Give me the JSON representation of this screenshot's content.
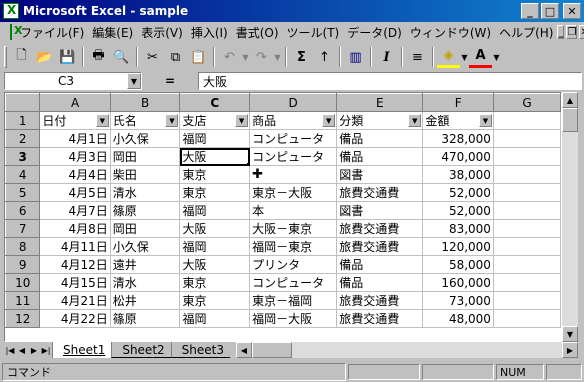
{
  "window": {
    "title": "Microsoft Excel - sample"
  },
  "menu": [
    "ファイル(F)",
    "編集(E)",
    "表示(V)",
    "挿入(I)",
    "書式(O)",
    "ツール(T)",
    "データ(D)",
    "ウィンドウ(W)",
    "ヘルプ(H)"
  ],
  "toolbar": {
    "buttons": [
      {
        "name": "new-icon",
        "glyph": "🗋"
      },
      {
        "name": "open-icon",
        "glyph": "📂"
      },
      {
        "name": "save-icon",
        "glyph": "💾"
      },
      {
        "name": "print-icon",
        "glyph": "🖶"
      },
      {
        "name": "print-preview-icon",
        "glyph": "🔍"
      },
      {
        "name": "cut-icon",
        "glyph": "✂"
      },
      {
        "name": "copy-icon",
        "glyph": "⧉"
      },
      {
        "name": "paste-icon",
        "glyph": "📋"
      },
      {
        "name": "undo-icon",
        "glyph": "↶"
      },
      {
        "name": "redo-icon",
        "glyph": "↷"
      },
      {
        "name": "autosum-icon",
        "glyph": "Σ"
      },
      {
        "name": "sort-ascending-icon",
        "glyph": "↑"
      },
      {
        "name": "chart-wizard-icon",
        "glyph": "▥"
      },
      {
        "name": "italic-icon",
        "glyph": "I"
      },
      {
        "name": "align-center-icon",
        "glyph": "≡"
      },
      {
        "name": "fill-color-icon",
        "glyph": "◈"
      },
      {
        "name": "font-color-icon",
        "glyph": "A"
      }
    ]
  },
  "formula_bar": {
    "name_box": "C3",
    "equals": "=",
    "value": "大阪"
  },
  "grid": {
    "columns": [
      "A",
      "B",
      "C",
      "D",
      "E",
      "F",
      "G"
    ],
    "active_column": "C",
    "active_row": 3,
    "headers": [
      "日付",
      "氏名",
      "支店",
      "商品",
      "分類",
      "金額"
    ],
    "rows": [
      [
        "4月1日",
        "小久保",
        "福岡",
        "コンピュータ",
        "備品",
        "328,000"
      ],
      [
        "4月3日",
        "岡田",
        "大阪",
        "コンピュータ",
        "備品",
        "470,000"
      ],
      [
        "4月4日",
        "柴田",
        "東京",
        "",
        "図書",
        "38,000"
      ],
      [
        "4月5日",
        "清水",
        "東京",
        "東京－大阪",
        "旅費交通費",
        "52,000"
      ],
      [
        "4月7日",
        "篠原",
        "福岡",
        "本",
        "図書",
        "52,000"
      ],
      [
        "4月8日",
        "岡田",
        "大阪",
        "大阪－東京",
        "旅費交通費",
        "83,000"
      ],
      [
        "4月11日",
        "小久保",
        "福岡",
        "福岡－東京",
        "旅費交通費",
        "120,000"
      ],
      [
        "4月12日",
        "遠井",
        "大阪",
        "プリンタ",
        "備品",
        "58,000"
      ],
      [
        "4月15日",
        "清水",
        "東京",
        "コンピュータ",
        "備品",
        "160,000"
      ],
      [
        "4月21日",
        "松井",
        "東京",
        "東京－福岡",
        "旅費交通費",
        "73,000"
      ],
      [
        "4月22日",
        "篠原",
        "福岡",
        "福岡－大阪",
        "旅費交通費",
        "48,000"
      ]
    ]
  },
  "sheets": [
    "Sheet1",
    "Sheet2",
    "Sheet3"
  ],
  "active_sheet": "Sheet1",
  "status": {
    "mode": "コマンド",
    "num": "NUM"
  }
}
